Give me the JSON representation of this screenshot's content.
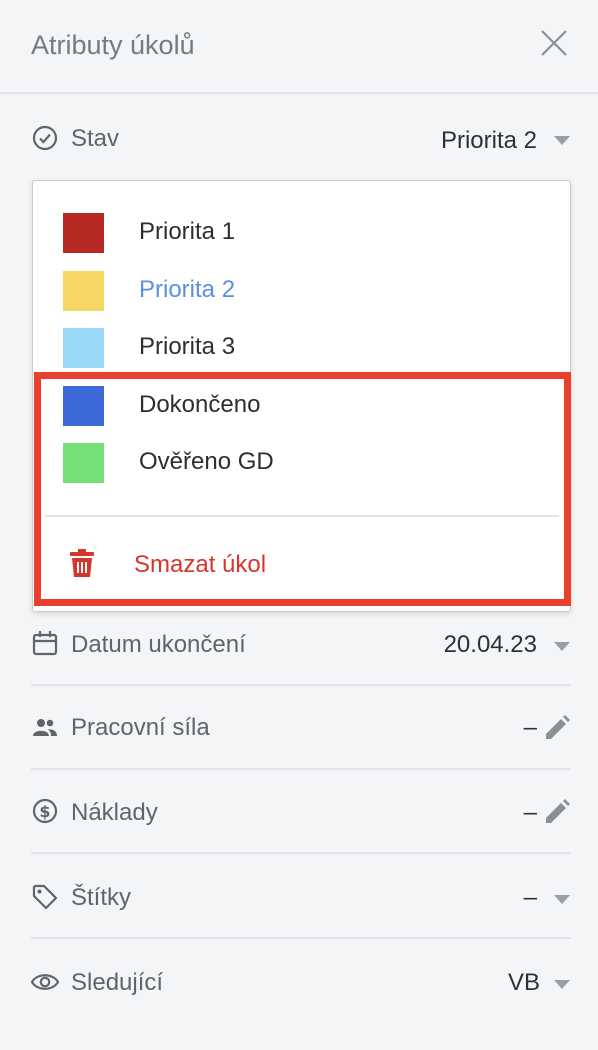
{
  "header": {
    "title": "Atributy úkolů",
    "close_icon": "close-icon"
  },
  "status": {
    "label": "Stav",
    "value": "Priorita 2",
    "icon": "check-circle-icon"
  },
  "dropdown": {
    "options": [
      {
        "label": "Priorita 1",
        "color": "#b72a23"
      },
      {
        "label": "Priorita 2",
        "color": "#f6d766",
        "selected": true
      },
      {
        "label": "Priorita 3",
        "color": "#9ad8f7"
      },
      {
        "label": "Dokončeno",
        "color": "#3e6ad8"
      },
      {
        "label": "Ověřeno GD",
        "color": "#74df74"
      }
    ],
    "delete_label": "Smazat úkol",
    "delete_color": "#d9342b",
    "highlight_color": "#e8402c"
  },
  "end_date": {
    "label": "Datum ukončení",
    "value": "20.04.23",
    "icon": "calendar-icon"
  },
  "workforce": {
    "label": "Pracovní síla",
    "value": "–",
    "icon": "people-icon"
  },
  "costs": {
    "label": "Náklady",
    "value": "–",
    "icon": "dollar-circle-icon"
  },
  "tags": {
    "label": "Štítky",
    "value": "–",
    "icon": "tag-icon"
  },
  "followers": {
    "label": "Sledující",
    "value": "VB",
    "icon": "eye-icon"
  }
}
